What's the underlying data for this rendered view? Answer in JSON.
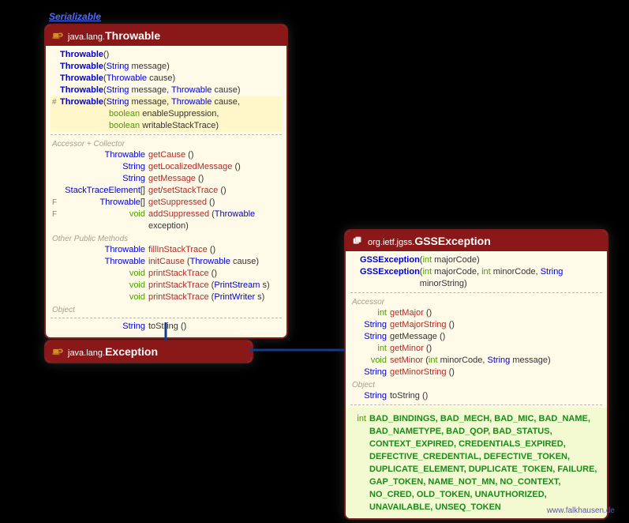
{
  "interface_label": "Serializable",
  "footer": "www.falkhausen.de",
  "throwable": {
    "pkg": "java.lang.",
    "name": "Throwable",
    "ctors": [
      {
        "mods": "",
        "name": "Throwable",
        "params": [
          {
            "text": "()",
            "cls": "plain"
          }
        ]
      },
      {
        "mods": "",
        "name": "Throwable",
        "params": [
          {
            "text": " (",
            "cls": "plain"
          },
          {
            "text": "String",
            "cls": "type"
          },
          {
            "text": " message)",
            "cls": "plain"
          }
        ]
      },
      {
        "mods": "",
        "name": "Throwable",
        "params": [
          {
            "text": " (",
            "cls": "plain"
          },
          {
            "text": "Throwable",
            "cls": "type"
          },
          {
            "text": " cause)",
            "cls": "plain"
          }
        ]
      },
      {
        "mods": "",
        "name": "Throwable",
        "params": [
          {
            "text": " (",
            "cls": "plain"
          },
          {
            "text": "String",
            "cls": "type"
          },
          {
            "text": " message, ",
            "cls": "plain"
          },
          {
            "text": "Throwable",
            "cls": "type"
          },
          {
            "text": " cause)",
            "cls": "plain"
          }
        ]
      },
      {
        "mods": "#",
        "name": "Throwable",
        "yellow": true,
        "params": [
          {
            "text": " (",
            "cls": "plain"
          },
          {
            "text": "String",
            "cls": "type"
          },
          {
            "text": " message, ",
            "cls": "plain"
          },
          {
            "text": "Throwable",
            "cls": "type"
          },
          {
            "text": " cause,",
            "cls": "plain"
          }
        ]
      },
      {
        "mods": "",
        "name": "",
        "yellow": true,
        "params": [
          {
            "text": "boolean",
            "cls": "kw"
          },
          {
            "text": " enableSuppression,",
            "cls": "plain"
          }
        ]
      },
      {
        "mods": "",
        "name": "",
        "yellow": true,
        "params": [
          {
            "text": "boolean",
            "cls": "kw"
          },
          {
            "text": " writableStackTrace)",
            "cls": "plain"
          }
        ]
      }
    ],
    "section_accessor": "Accessor + Collector",
    "accessors": [
      {
        "ret": [
          {
            "text": "Throwable",
            "cls": "type"
          }
        ],
        "name": [
          {
            "text": "getCause",
            "cls": "mname"
          },
          {
            "text": " ()",
            "cls": "plain"
          }
        ]
      },
      {
        "ret": [
          {
            "text": "String",
            "cls": "type"
          }
        ],
        "name": [
          {
            "text": "getLocalizedMessage",
            "cls": "mname"
          },
          {
            "text": " ()",
            "cls": "plain"
          }
        ]
      },
      {
        "ret": [
          {
            "text": "String",
            "cls": "type"
          }
        ],
        "name": [
          {
            "text": "getMessage",
            "cls": "mname"
          },
          {
            "text": " ()",
            "cls": "plain"
          }
        ]
      },
      {
        "ret": [
          {
            "text": "StackTraceElement",
            "cls": "type"
          },
          {
            "text": "[]",
            "cls": "plain"
          }
        ],
        "name": [
          {
            "text": "get",
            "cls": "mname"
          },
          {
            "text": "/",
            "cls": "plain"
          },
          {
            "text": "setStackTrace",
            "cls": "mname"
          },
          {
            "text": " ()",
            "cls": "plain"
          }
        ]
      },
      {
        "mods": "F",
        "ret": [
          {
            "text": "Throwable",
            "cls": "type"
          },
          {
            "text": "[]",
            "cls": "plain"
          }
        ],
        "name": [
          {
            "text": "getSuppressed",
            "cls": "mname"
          },
          {
            "text": " ()",
            "cls": "plain"
          }
        ]
      },
      {
        "mods": "F",
        "ret": [
          {
            "text": "void",
            "cls": "kw"
          }
        ],
        "name": [
          {
            "text": "addSuppressed",
            "cls": "mname"
          },
          {
            "text": " (",
            "cls": "plain"
          },
          {
            "text": "Throwable",
            "cls": "type"
          },
          {
            "text": " exception)",
            "cls": "plain"
          }
        ]
      }
    ],
    "section_other": "Other Public Methods",
    "others": [
      {
        "ret": [
          {
            "text": "Throwable",
            "cls": "type"
          }
        ],
        "name": [
          {
            "text": "fillInStackTrace",
            "cls": "mname"
          },
          {
            "text": " ()",
            "cls": "plain"
          }
        ]
      },
      {
        "ret": [
          {
            "text": "Throwable",
            "cls": "type"
          }
        ],
        "name": [
          {
            "text": "initCause",
            "cls": "mname"
          },
          {
            "text": " (",
            "cls": "plain"
          },
          {
            "text": "Throwable",
            "cls": "type"
          },
          {
            "text": " cause)",
            "cls": "plain"
          }
        ]
      },
      {
        "ret": [
          {
            "text": "void",
            "cls": "kw"
          }
        ],
        "name": [
          {
            "text": "printStackTrace",
            "cls": "mname"
          },
          {
            "text": " ()",
            "cls": "plain"
          }
        ]
      },
      {
        "ret": [
          {
            "text": "void",
            "cls": "kw"
          }
        ],
        "name": [
          {
            "text": "printStackTrace",
            "cls": "mname"
          },
          {
            "text": " (",
            "cls": "plain"
          },
          {
            "text": "PrintStream",
            "cls": "type"
          },
          {
            "text": " s)",
            "cls": "plain"
          }
        ]
      },
      {
        "ret": [
          {
            "text": "void",
            "cls": "kw"
          }
        ],
        "name": [
          {
            "text": "printStackTrace",
            "cls": "mname"
          },
          {
            "text": " (",
            "cls": "plain"
          },
          {
            "text": "PrintWriter",
            "cls": "type"
          },
          {
            "text": " s)",
            "cls": "plain"
          }
        ]
      }
    ],
    "section_object": "Object",
    "objmethods": [
      {
        "ret": [
          {
            "text": "String",
            "cls": "type"
          }
        ],
        "name": [
          {
            "text": "toString",
            "cls": "plain"
          },
          {
            "text": " ()",
            "cls": "plain"
          }
        ]
      }
    ]
  },
  "exception": {
    "pkg": "java.lang.",
    "name": "Exception"
  },
  "gss": {
    "pkg": "org.ietf.jgss.",
    "name": "GSSException",
    "ctors": [
      {
        "name": "GSSException",
        "params": [
          {
            "text": " (",
            "cls": "plain"
          },
          {
            "text": "int",
            "cls": "kw"
          },
          {
            "text": " majorCode)",
            "cls": "plain"
          }
        ]
      },
      {
        "name": "GSSException",
        "params": [
          {
            "text": " (",
            "cls": "plain"
          },
          {
            "text": "int",
            "cls": "kw"
          },
          {
            "text": " majorCode, ",
            "cls": "plain"
          },
          {
            "text": "int",
            "cls": "kw"
          },
          {
            "text": " minorCode, ",
            "cls": "plain"
          },
          {
            "text": "String",
            "cls": "type"
          },
          {
            "text": " minorString)",
            "cls": "plain"
          }
        ]
      }
    ],
    "section_accessor": "Accessor",
    "accessors": [
      {
        "ret": [
          {
            "text": "int",
            "cls": "kw"
          }
        ],
        "name": [
          {
            "text": "getMajor",
            "cls": "mname"
          },
          {
            "text": " ()",
            "cls": "plain"
          }
        ]
      },
      {
        "ret": [
          {
            "text": "String",
            "cls": "type"
          }
        ],
        "name": [
          {
            "text": "getMajorString",
            "cls": "mname"
          },
          {
            "text": " ()",
            "cls": "plain"
          }
        ]
      },
      {
        "ret": [
          {
            "text": "String",
            "cls": "type"
          }
        ],
        "name": [
          {
            "text": "getMessage",
            "cls": "plain"
          },
          {
            "text": " ()",
            "cls": "plain"
          }
        ]
      },
      {
        "ret": [
          {
            "text": "int",
            "cls": "kw"
          }
        ],
        "name": [
          {
            "text": "getMinor",
            "cls": "mname"
          },
          {
            "text": " ()",
            "cls": "plain"
          }
        ]
      },
      {
        "ret": [
          {
            "text": "void",
            "cls": "kw"
          }
        ],
        "name": [
          {
            "text": "setMinor",
            "cls": "mname"
          },
          {
            "text": " (",
            "cls": "plain"
          },
          {
            "text": "int",
            "cls": "kw"
          },
          {
            "text": " minorCode, ",
            "cls": "plain"
          },
          {
            "text": "String",
            "cls": "type"
          },
          {
            "text": " message)",
            "cls": "plain"
          }
        ]
      },
      {
        "ret": [
          {
            "text": "String",
            "cls": "type"
          }
        ],
        "name": [
          {
            "text": "getMinorString",
            "cls": "mname"
          },
          {
            "text": " ()",
            "cls": "plain"
          }
        ]
      }
    ],
    "section_object": "Object",
    "objmethods": [
      {
        "ret": [
          {
            "text": "String",
            "cls": "type"
          }
        ],
        "name": [
          {
            "text": "toString",
            "cls": "plain"
          },
          {
            "text": " ()",
            "cls": "plain"
          }
        ]
      }
    ],
    "constants_ret": "int",
    "constants": "BAD_BINDINGS, BAD_MECH, BAD_MIC, BAD_NAME, BAD_NAMETYPE, BAD_QOP, BAD_STATUS, CONTEXT_EXPIRED, CREDENTIALS_EXPIRED, DEFECTIVE_CREDENTIAL, DEFECTIVE_TOKEN, DUPLICATE_ELEMENT, DUPLICATE_TOKEN, FAILURE, GAP_TOKEN, NAME_NOT_MN, NO_CONTEXT, NO_CRED, OLD_TOKEN, UNAUTHORIZED, UNAVAILABLE, UNSEQ_TOKEN"
  }
}
